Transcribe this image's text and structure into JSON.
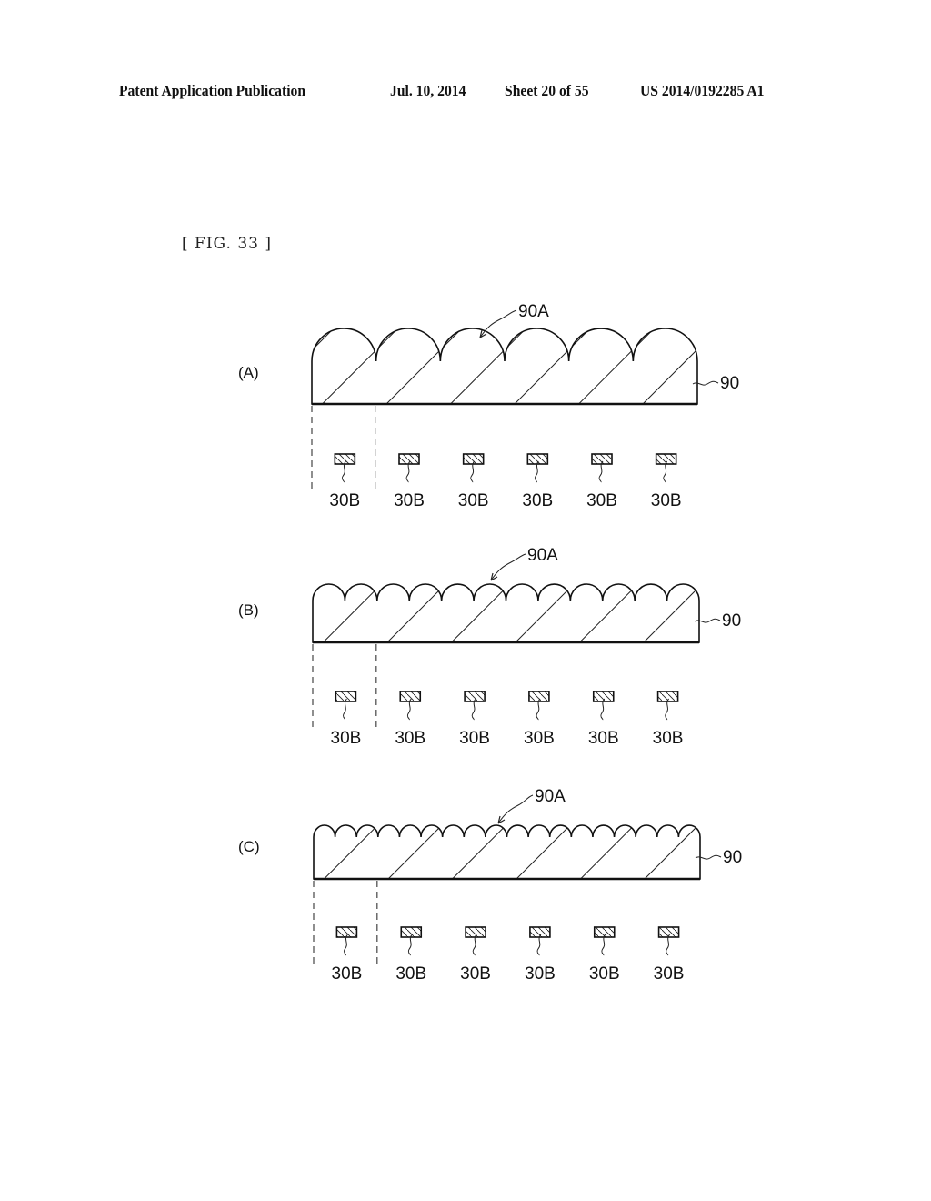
{
  "header": {
    "publication": "Patent Application Publication",
    "date": "Jul. 10, 2014",
    "sheet": "Sheet 20 of 55",
    "number": "US 2014/0192285 A1"
  },
  "figure": {
    "label": "[ FIG. 33 ]",
    "panels": [
      {
        "id": "A",
        "label": "(A)",
        "lens_count": 6,
        "lens_array_label": "90A",
        "body_label": "90",
        "emitter_labels": [
          "30B",
          "30B",
          "30B",
          "30B",
          "30B",
          "30B"
        ]
      },
      {
        "id": "B",
        "label": "(B)",
        "lens_count": 12,
        "lens_array_label": "90A",
        "body_label": "90",
        "emitter_labels": [
          "30B",
          "30B",
          "30B",
          "30B",
          "30B",
          "30B"
        ]
      },
      {
        "id": "C",
        "label": "(C)",
        "lens_count": 18,
        "lens_array_label": "90A",
        "body_label": "90",
        "emitter_labels": [
          "30B",
          "30B",
          "30B",
          "30B",
          "30B",
          "30B"
        ]
      }
    ]
  },
  "colors": {
    "ink": "#111111",
    "paper": "#ffffff"
  }
}
